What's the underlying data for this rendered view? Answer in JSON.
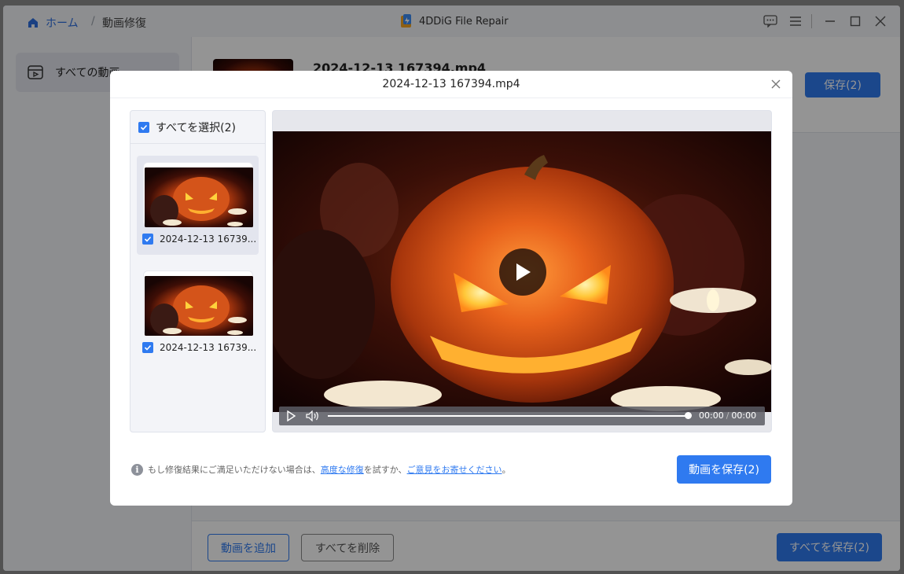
{
  "titlebar": {
    "home_label": "ホーム",
    "separator": "/",
    "current": "動画修復",
    "app_title": "4DDiG File Repair"
  },
  "sidebar": {
    "items": [
      {
        "label": "すべての動画"
      }
    ]
  },
  "main": {
    "file_name": "2024-12-13 167394.mp4",
    "save_label": "保存(2)"
  },
  "bottom": {
    "add_label": "動画を追加",
    "delete_all_label": "すべてを削除",
    "save_all_label": "すべてを保存(2)"
  },
  "modal": {
    "title": "2024-12-13 167394.mp4",
    "select_all_label": "すべてを選択(2)",
    "files": [
      {
        "name": "2024-12-13 16739...",
        "checked": true,
        "selected": true
      },
      {
        "name": "2024-12-13 16739...",
        "checked": true,
        "selected": false
      }
    ],
    "player": {
      "current_time": "00:00",
      "separator": "/",
      "duration": "00:00",
      "progress": 1.0
    },
    "footnote": {
      "prefix": "もし修復結果にご満足いただけない場合は、",
      "link1": "高度な修復",
      "middle": "を試すか、",
      "link2": "ご意見をお寄せください",
      "suffix": "。"
    },
    "save_button": "動画を保存(2)"
  },
  "colors": {
    "accent": "#2f7af0",
    "checkbox": "#2f7af0"
  },
  "icons": {
    "home": "home-icon",
    "logo": "app-logo-icon",
    "feedback": "feedback-icon",
    "menu": "menu-icon",
    "minimize": "minimize-icon",
    "maximize": "maximize-icon",
    "close": "close-icon",
    "video": "video-icon",
    "play": "play-icon",
    "volume": "volume-icon",
    "info": "info-icon"
  }
}
